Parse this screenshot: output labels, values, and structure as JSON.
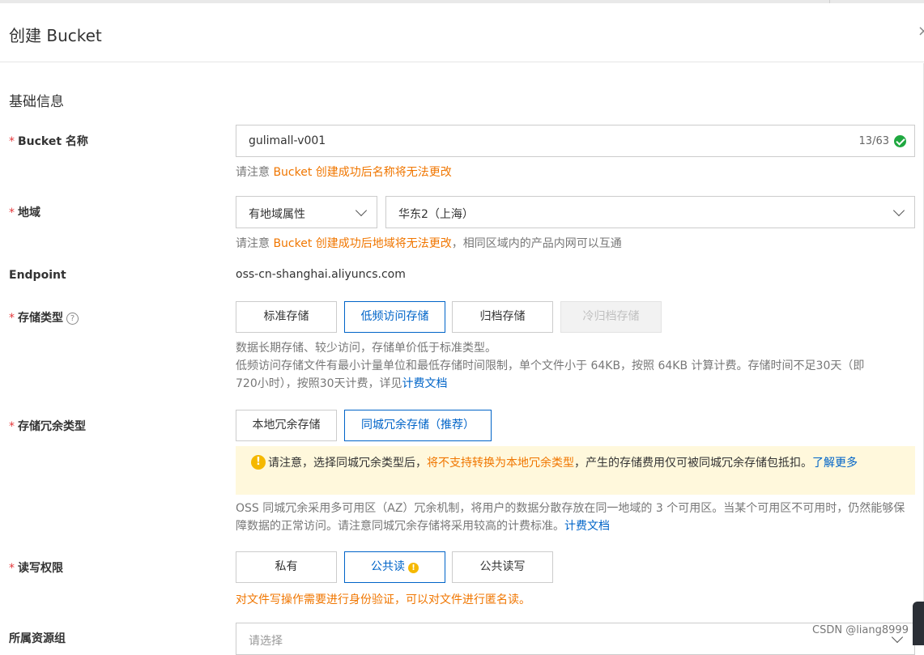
{
  "dialog": {
    "title": "创建 Bucket",
    "close_glyph": "×"
  },
  "section": {
    "title": "基础信息"
  },
  "required_mark": "*",
  "bucket_name": {
    "label": "Bucket 名称",
    "value": "gulimall-v001",
    "count": "13/63",
    "hint_prefix": "请注意 ",
    "hint_highlight": "Bucket 创建成功后名称将无法更改"
  },
  "region": {
    "label": "地域",
    "type_value": "有地域属性",
    "region_value": "华东2（上海）",
    "hint_prefix": "请注意 ",
    "hint_highlight": "Bucket 创建成功后地域将无法更改",
    "hint_suffix": "，相同区域内的产品内网可以互通"
  },
  "endpoint": {
    "label": "Endpoint",
    "value": "oss-cn-shanghai.aliyuncs.com"
  },
  "storage_class": {
    "label": "存储类型",
    "help_glyph": "?",
    "options": [
      "标准存储",
      "低频访问存储",
      "归档存储",
      "冷归档存储"
    ],
    "selected": "低频访问存储",
    "desc1": "数据长期存储、较少访问，存储单价低于标准类型。",
    "desc2_part1": "低频访问存储文件有最小计量单位和最低存储时间限制，单个文件小于 64KB，按照 64KB 计算计费。存储时间不足30天（即",
    "desc2_part2": "720小时），按照30天计费，详见",
    "desc2_link": "计费文档"
  },
  "redundancy": {
    "label": "存储冗余类型",
    "options": [
      "本地冗余存储",
      "同城冗余存储（推荐）"
    ],
    "selected": "同城冗余存储（推荐）",
    "notice_icon": "!",
    "notice_prefix": "请注意，选择同城冗余类型后，",
    "notice_highlight": "将不支持转换为本地冗余类型",
    "notice_suffix": "，产生的存储费用仅可被同城冗余存储包抵扣。",
    "notice_link": "了解更多",
    "desc": "OSS 同城冗余采用多可用区（AZ）冗余机制，将用户的数据分散存放在同一地域的 3 个可用区。当某个可用区不可用时，仍然能够保障数据的正常访问。请注意同城冗余存储将采用较高的计费标准。",
    "desc_link": "计费文档"
  },
  "acl": {
    "label": "读写权限",
    "options": [
      "私有",
      "公共读",
      "公共读写"
    ],
    "selected": "公共读",
    "warn_glyph": "!",
    "hint": "对文件写操作需要进行身份验证，可以对文件进行匿名读。"
  },
  "resource_group": {
    "label": "所属资源组",
    "placeholder": "请选择"
  },
  "watermark": "CSDN @liang8999",
  "colors": {
    "primary": "#0064c8",
    "warning": "#f07600",
    "required": "#e4393c",
    "success": "#1fa840",
    "notice_bg": "#fff8dc"
  }
}
